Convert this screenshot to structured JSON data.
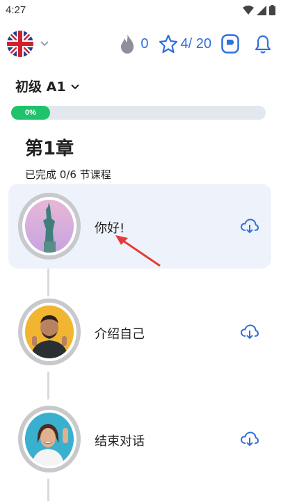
{
  "status_bar": {
    "time": "4:27",
    "icons": [
      "wifi-icon",
      "signal-icon",
      "battery-icon"
    ]
  },
  "header": {
    "language_flag": "uk-flag-icon",
    "streak_count": "0",
    "stars": "4/ 20",
    "accent_color": "#2f6fe0"
  },
  "level": {
    "label": "初级 A1"
  },
  "progress": {
    "percent_label": "0%",
    "fill_color": "#1fc36b"
  },
  "chapter": {
    "title": "第1章",
    "subtitle": "已完成 0/6 节课程"
  },
  "lessons": [
    {
      "title": "你好!",
      "image": "statue-of-liberty-photo",
      "active": true
    },
    {
      "title": "介绍自己",
      "image": "man-portrait-photo",
      "active": false
    },
    {
      "title": "结束对话",
      "image": "woman-waving-photo",
      "active": false
    }
  ]
}
